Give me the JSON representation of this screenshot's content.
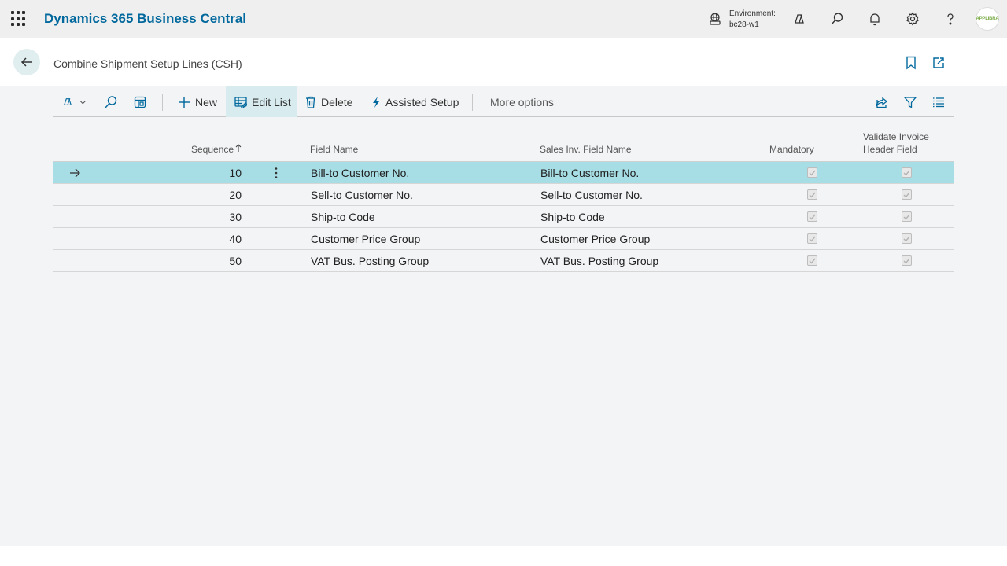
{
  "app": {
    "title": "Dynamics 365 Business Central",
    "environment_label": "Environment:",
    "environment_value": "bc28-w1",
    "avatar_text": "APPLIBRA"
  },
  "page": {
    "title": "Combine Shipment Setup Lines (CSH)"
  },
  "actions": {
    "new": "New",
    "edit_list": "Edit List",
    "delete": "Delete",
    "assisted_setup": "Assisted Setup",
    "more_options": "More options"
  },
  "columns": {
    "sequence": "Sequence",
    "field_name": "Field Name",
    "sales_inv_field_name": "Sales Inv. Field Name",
    "mandatory": "Mandatory",
    "validate_line1": "Validate Invoice",
    "validate_line2": "Header Field"
  },
  "rows": [
    {
      "sequence": "10",
      "field_name": "Bill-to Customer No.",
      "sales_inv_field_name": "Bill-to Customer No.",
      "mandatory": true,
      "validate": true
    },
    {
      "sequence": "20",
      "field_name": "Sell-to Customer No.",
      "sales_inv_field_name": "Sell-to Customer No.",
      "mandatory": true,
      "validate": true
    },
    {
      "sequence": "30",
      "field_name": "Ship-to Code",
      "sales_inv_field_name": "Ship-to Code",
      "mandatory": true,
      "validate": true
    },
    {
      "sequence": "40",
      "field_name": "Customer Price Group",
      "sales_inv_field_name": "Customer Price Group",
      "mandatory": true,
      "validate": true
    },
    {
      "sequence": "50",
      "field_name": "VAT Bus. Posting Group",
      "sales_inv_field_name": "VAT Bus. Posting Group",
      "mandatory": true,
      "validate": true
    }
  ],
  "colors": {
    "brand": "#00689d",
    "selected_row": "#a7dde4",
    "selected_action": "#d8ecf0"
  }
}
